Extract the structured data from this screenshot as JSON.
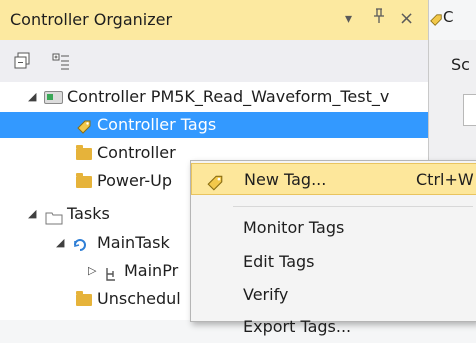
{
  "panel": {
    "title": "Controller Organizer",
    "dropdown_glyph": "▾",
    "pin_glyph": "ₚ",
    "close_glyph": "×"
  },
  "toolbar": {
    "icons": [
      "collapse-all-icon",
      "expand-all-icon"
    ]
  },
  "tree": {
    "controller": "Controller PM5K_Read_Waveform_Test_v",
    "controller_tags": "Controller Tags",
    "controller_fault": "Controller",
    "power_up": "Power-Up",
    "tasks": "Tasks",
    "main_task": "MainTask",
    "main_program": "MainPr",
    "unscheduled": "Unschedul",
    "expanded_glyph": "◢",
    "collapsed_glyph": "▷"
  },
  "right_pane": {
    "tab_text": "C",
    "scope_text": "Sc"
  },
  "context_menu": {
    "items": [
      {
        "label": "New Tag...",
        "shortcut": "Ctrl+W"
      },
      {
        "label": "Monitor Tags",
        "shortcut": ""
      },
      {
        "label": "Edit Tags",
        "shortcut": ""
      },
      {
        "label": "Verify",
        "shortcut": ""
      },
      {
        "label": "Export Tags...",
        "shortcut": ""
      }
    ]
  },
  "colors": {
    "title_bar": "#fce9a0",
    "selection": "#3399ff",
    "menu_highlight": "#fde79b",
    "folder": "#e6b33a",
    "tag_icon": "#f2c84b"
  }
}
